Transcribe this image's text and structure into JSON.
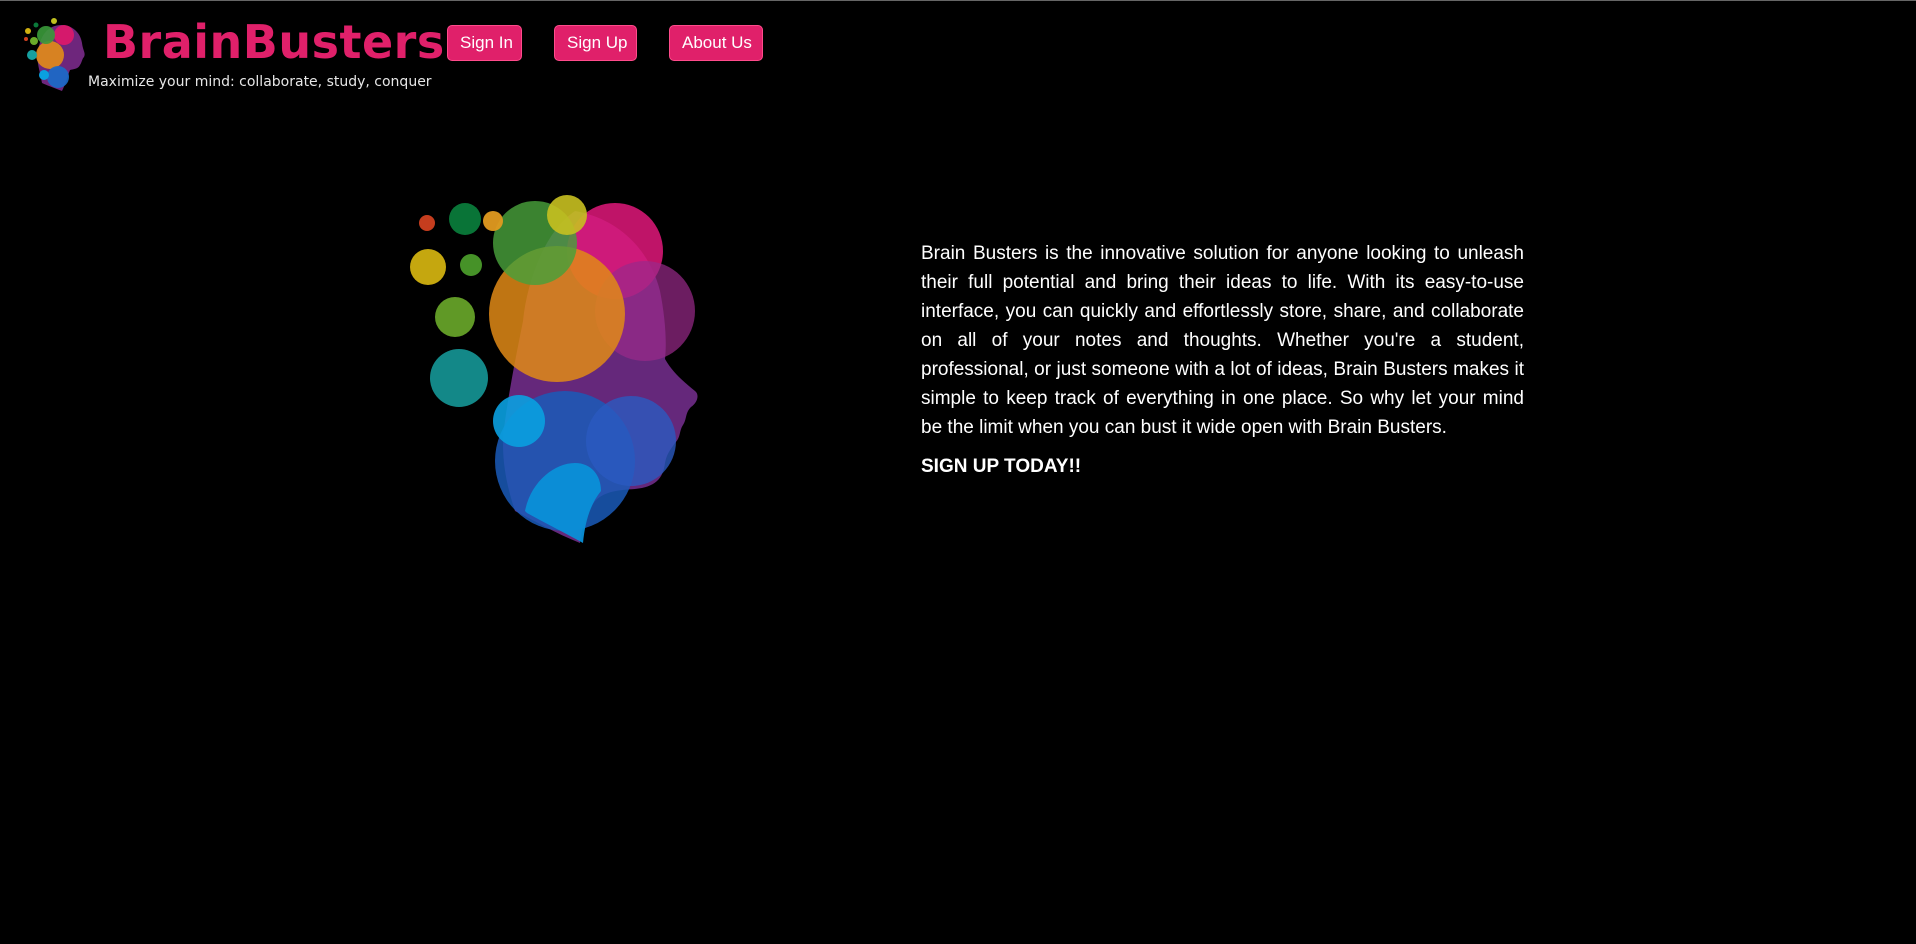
{
  "colors": {
    "background": "#000000",
    "brand": "#e0206a",
    "text": "#ffffff",
    "tagline": "#e6e6e6"
  },
  "header": {
    "logo_icon": "colorful-head-icon",
    "brand_name": "BrainBusters",
    "tagline": "Maximize your mind: collaborate, study, conquer"
  },
  "nav": {
    "sign_in_label": "Sign In",
    "sign_up_label": "Sign Up",
    "about_label": "About Us"
  },
  "hero": {
    "illustration_icon": "brain-bubbles-head-icon",
    "description": "Brain Busters is the innovative solution for anyone looking to unleash their full potential and bring their ideas to life. With its easy-to-use interface, you can quickly and effortlessly store, share, and collaborate on all of your notes and thoughts. Whether you're a student, professional, or just someone with a lot of ideas, Brain Busters makes it simple to keep track of everything in one place. So why let your mind be the limit when you can bust it wide open with Brain Busters.",
    "cta": "SIGN UP TODAY!!"
  }
}
